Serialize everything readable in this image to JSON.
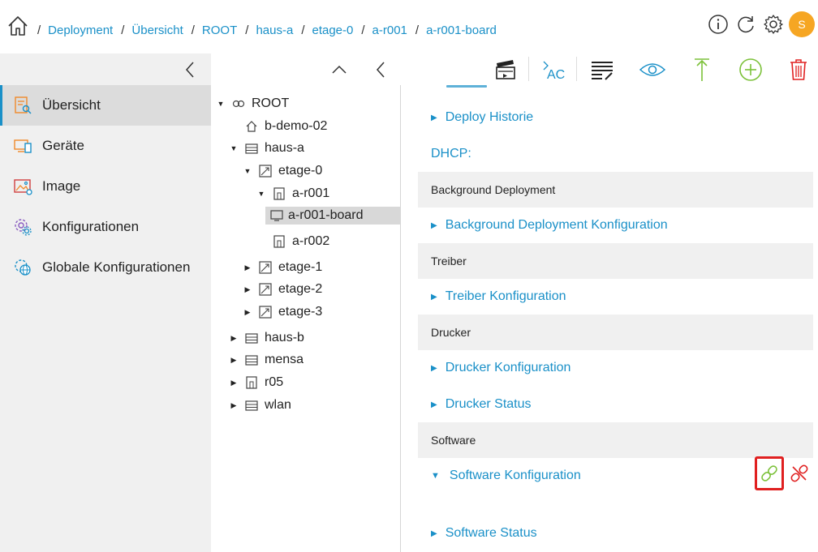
{
  "breadcrumb": {
    "items": [
      "Deployment",
      "Übersicht",
      "ROOT",
      "haus-a",
      "etage-0",
      "a-r001",
      "a-r001-board"
    ]
  },
  "user": {
    "avatar_initial": "S",
    "avatar_color": "#f6a623"
  },
  "sidebar": {
    "items": [
      {
        "label": "Übersicht",
        "icon": "overview-icon",
        "active": true
      },
      {
        "label": "Geräte",
        "icon": "devices-icon"
      },
      {
        "label": "Image",
        "icon": "image-icon"
      },
      {
        "label": "Konfigurationen",
        "icon": "config-icon"
      },
      {
        "label": "Globale Konfigurationen",
        "icon": "global-config-icon"
      }
    ]
  },
  "tree": {
    "nodes": [
      {
        "label": "ROOT",
        "icon": "root-icon",
        "toggle": "open"
      },
      {
        "label": "b-demo-02",
        "icon": "house-icon"
      },
      {
        "label": "haus-a",
        "icon": "building-icon",
        "toggle": "open"
      },
      {
        "label": "etage-0",
        "icon": "floor-icon",
        "toggle": "open"
      },
      {
        "label": "a-r001",
        "icon": "room-icon",
        "toggle": "open"
      },
      {
        "label": "a-r001-board",
        "icon": "board-icon",
        "selected": true
      },
      {
        "label": "a-r002",
        "icon": "room-icon"
      },
      {
        "label": "etage-1",
        "icon": "floor-icon",
        "toggle": "closed"
      },
      {
        "label": "etage-2",
        "icon": "floor-icon",
        "toggle": "closed"
      },
      {
        "label": "etage-3",
        "icon": "floor-icon",
        "toggle": "closed"
      },
      {
        "label": "haus-b",
        "icon": "building-icon",
        "toggle": "closed"
      },
      {
        "label": "mensa",
        "icon": "building-icon",
        "toggle": "closed"
      },
      {
        "label": "r05",
        "icon": "room-icon",
        "toggle": "closed"
      },
      {
        "label": "wlan",
        "icon": "building-icon",
        "toggle": "closed"
      }
    ]
  },
  "detail": {
    "deploy_historie": "Deploy Historie",
    "dhcp_label": "DHCP:",
    "sections": [
      {
        "header": "Background Deployment",
        "links": [
          "Background Deployment Konfiguration"
        ]
      },
      {
        "header": "Treiber",
        "links": [
          "Treiber Konfiguration"
        ]
      },
      {
        "header": "Drucker",
        "links": [
          "Drucker Konfiguration",
          "Drucker Status"
        ]
      },
      {
        "header": "Software",
        "links": [
          "Software Konfiguration",
          "Software Status"
        ]
      }
    ]
  },
  "colors": {
    "accent": "#1a90c8",
    "green": "#7cc13a",
    "red": "#e02020"
  }
}
